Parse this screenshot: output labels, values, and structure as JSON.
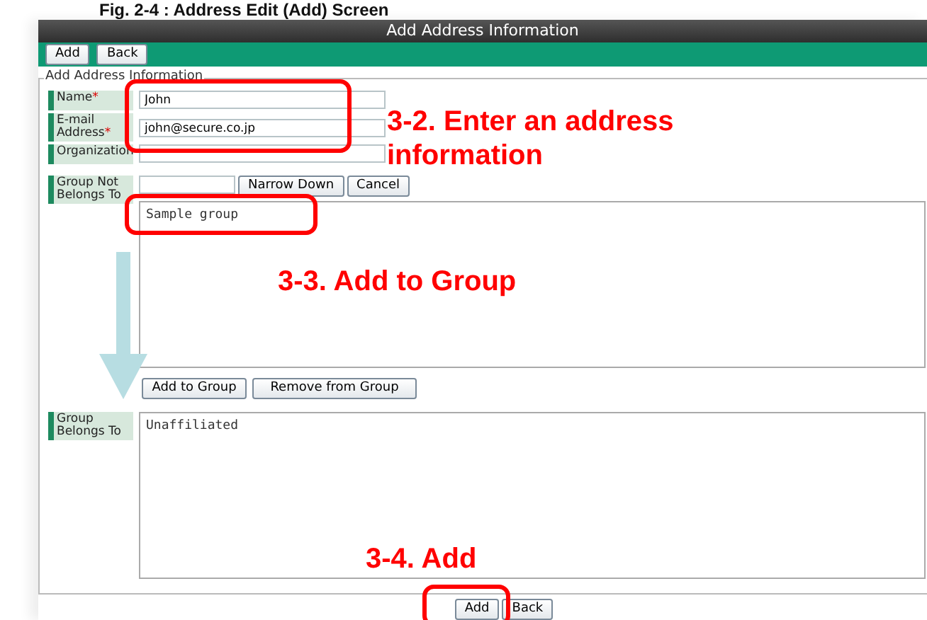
{
  "caption": "Fig. 2-4 : Address Edit (Add) Screen",
  "window": {
    "title": "Add Address Information"
  },
  "toolbar": {
    "buttons": [
      "Add",
      "Back"
    ]
  },
  "form": {
    "legend": "Add Address Information",
    "fields": [
      {
        "label": "Name",
        "required_mark": "*",
        "value": "John"
      },
      {
        "label": "E-mail Address",
        "required_mark": "*",
        "value": "john@secure.co.jp"
      },
      {
        "label": "Organization"
      }
    ],
    "group_not_belongs": {
      "label": "Group Not Belongs To",
      "search_buttons": [
        "Narrow Down",
        "Cancel"
      ],
      "items": [
        "Sample group"
      ]
    },
    "move_buttons": [
      "Add to Group",
      "Remove from Group"
    ],
    "group_belongs": {
      "label": "Group Belongs To",
      "items": [
        "Unaffiliated"
      ]
    }
  },
  "footer_buttons": [
    "Add",
    "Back"
  ],
  "annotations": [
    {
      "text": "3-2. Enter an address information"
    },
    {
      "text": "3-3. Add to Group"
    },
    {
      "text": "3-4. Add"
    }
  ]
}
